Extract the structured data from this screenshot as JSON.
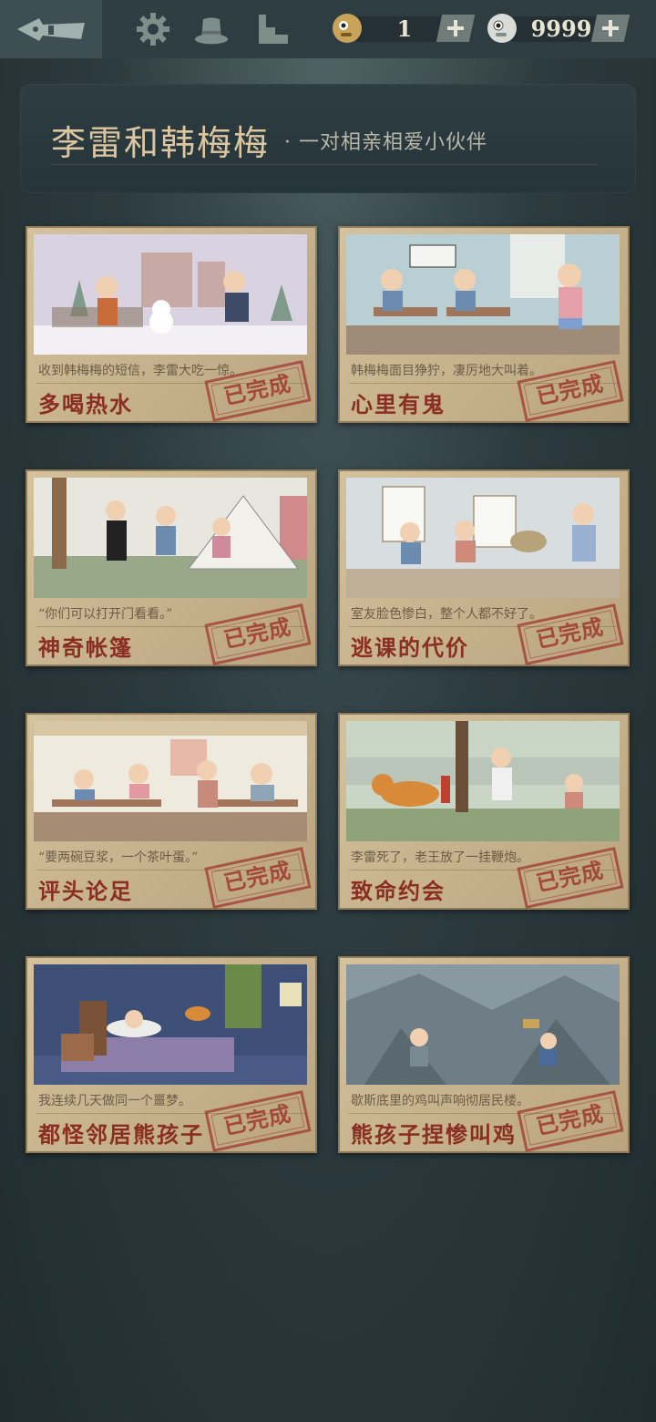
{
  "topbar": {
    "icons": [
      "back-pen-icon",
      "gear-icon",
      "hat-icon",
      "stairs-icon"
    ],
    "counter_left": {
      "icon": "coin-character-icon",
      "value": "1"
    },
    "counter_right": {
      "icon": "coin-character-icon",
      "value": "9999"
    }
  },
  "header": {
    "title": "李雷和韩梅梅",
    "subtitle": "· 一对相亲相爱小伙伴"
  },
  "stamp_label": "已完成",
  "levels": [
    {
      "name": "多喝热水",
      "caption": "收到韩梅梅的短信，李雷大吃一惊。",
      "status": "已完成",
      "scene": "snow"
    },
    {
      "name": "心里有鬼",
      "caption": "韩梅梅面目狰狞，凄厉地大叫着。",
      "status": "已完成",
      "scene": "classroom"
    },
    {
      "name": "神奇帐篷",
      "caption": "“你们可以打开门看看。”",
      "status": "已完成",
      "scene": "tent"
    },
    {
      "name": "逃课的代价",
      "caption": "室友脸色惨白，整个人都不好了。",
      "status": "已完成",
      "scene": "art"
    },
    {
      "name": "评头论足",
      "caption": "“要两碗豆浆，一个茶叶蛋。”",
      "status": "已完成",
      "scene": "breakfast"
    },
    {
      "name": "致命约会",
      "caption": "李雷死了，老王放了一挂鞭炮。",
      "status": "已完成",
      "scene": "tiger"
    },
    {
      "name": "都怪邻居熊孩子",
      "caption": "我连续几天做同一个噩梦。",
      "status": "已完成",
      "scene": "bed"
    },
    {
      "name": "熊孩子捏惨叫鸡",
      "caption": "歇斯底里的鸡叫声响彻居民楼。",
      "status": "已完成",
      "scene": "rubble"
    }
  ],
  "colors": {
    "accent": "#8a2e23",
    "card": "#cbb793",
    "background": "#2c3b3f"
  }
}
